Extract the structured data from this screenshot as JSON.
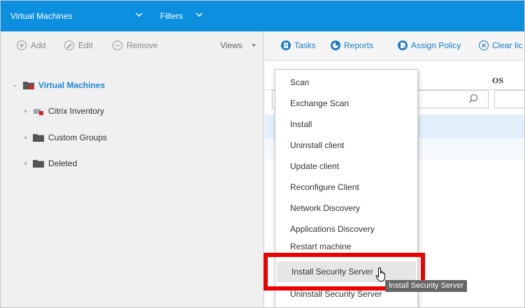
{
  "topbar": {
    "title": "Virtual Machines",
    "filters_label": "Filters"
  },
  "left_toolbar": {
    "add_label": "Add",
    "edit_label": "Edit",
    "remove_label": "Remove",
    "views_label": "Views"
  },
  "tree": {
    "root_label": "Virtual Machines",
    "items": [
      {
        "label": "Citrix Inventory"
      },
      {
        "label": "Custom Groups"
      },
      {
        "label": "Deleted"
      }
    ]
  },
  "right_toolbar": {
    "tasks_label": "Tasks",
    "reports_label": "Reports",
    "assign_policy_label": "Assign Policy",
    "clear_label": "Clear lic"
  },
  "grid": {
    "os_header": "OS"
  },
  "tasks_menu": {
    "items": [
      {
        "label": "Scan"
      },
      {
        "label": "Exchange Scan"
      },
      {
        "label": "Install"
      },
      {
        "label": "Uninstall client"
      },
      {
        "label": "Update client"
      },
      {
        "label": "Reconfigure Client"
      },
      {
        "label": "Network Discovery"
      },
      {
        "label": "Applications Discovery"
      },
      {
        "label": "Restart machine"
      },
      {
        "label": "Install Security Server"
      },
      {
        "label": "Uninstall Security Server"
      }
    ]
  },
  "tooltip": {
    "text": "Install Security Server"
  },
  "colors": {
    "topbar": "#0d8fe0",
    "accent": "#1a7cc9",
    "highlight": "#ee0000"
  }
}
